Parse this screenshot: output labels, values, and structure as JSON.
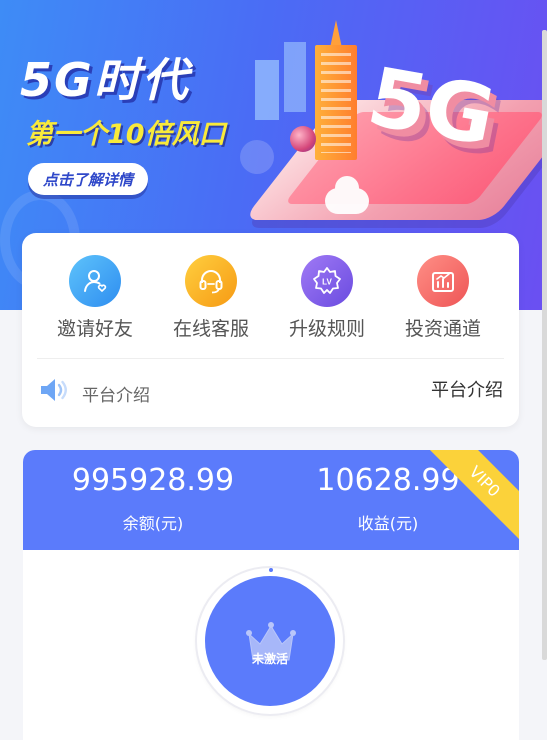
{
  "banner": {
    "title": "5G时代",
    "subtitle": "第一个10倍风口",
    "cta_label": "点击了解详情",
    "illustration_text": "5G"
  },
  "menu": {
    "items": [
      {
        "label": "邀请好友",
        "icon": "invite-friend-icon",
        "color": "#2e8df0"
      },
      {
        "label": "在线客服",
        "icon": "headset-icon",
        "color": "#f69a14"
      },
      {
        "label": "升级规则",
        "icon": "level-badge-icon",
        "color": "#6a4be0"
      },
      {
        "label": "投资通道",
        "icon": "chart-icon",
        "color": "#ee5556"
      }
    ],
    "notice_label": "平台介绍",
    "notice_link": "平台介绍"
  },
  "balance": {
    "amount_value": "995928.99",
    "amount_label": "余额(元)",
    "income_value": "10628.99",
    "income_label": "收益(元)",
    "vip_badge": "VIP0",
    "status_text": "未激活",
    "accent_color": "#5b7bfb"
  }
}
